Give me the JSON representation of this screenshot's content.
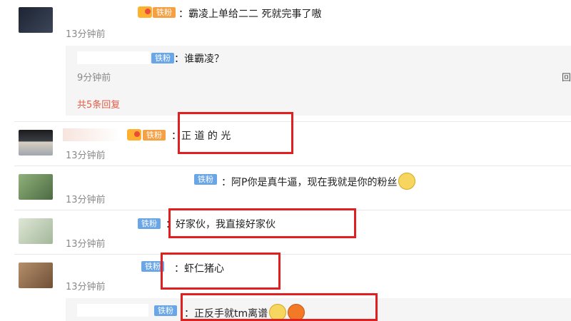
{
  "badges": {
    "tiefen": "铁粉"
  },
  "comments": [
    {
      "text": "：霸凌上单给二二 死就完事了嗷",
      "time": "13分钟前"
    },
    {
      "text": "：正 道 的 光",
      "time": "13分钟前"
    },
    {
      "text": "：阿P你是真牛逼，现在我就是你的粉丝",
      "time": "13分钟前"
    },
    {
      "text": "：好家伙，我直接好家伙",
      "time": "13分钟前"
    },
    {
      "text": "：虾仁猪心",
      "time": "13分钟前"
    }
  ],
  "reply1": {
    "text": "：谁霸凌？",
    "time": "9分钟前",
    "more": "共5条回复",
    "cut_right": "回"
  },
  "reply2": {
    "text": "：正反手就tm离谱"
  },
  "colors": {
    "highlight_box": "#e02020",
    "badge_blue": "#6aa6e6",
    "badge_orange": "#f4a043",
    "more_link": "#e25b45"
  },
  "icons": {
    "level": "level-heart-icon",
    "emoji_dog": "doge-emoji-icon",
    "emoji_laugh": "laugh-emoji-icon"
  }
}
